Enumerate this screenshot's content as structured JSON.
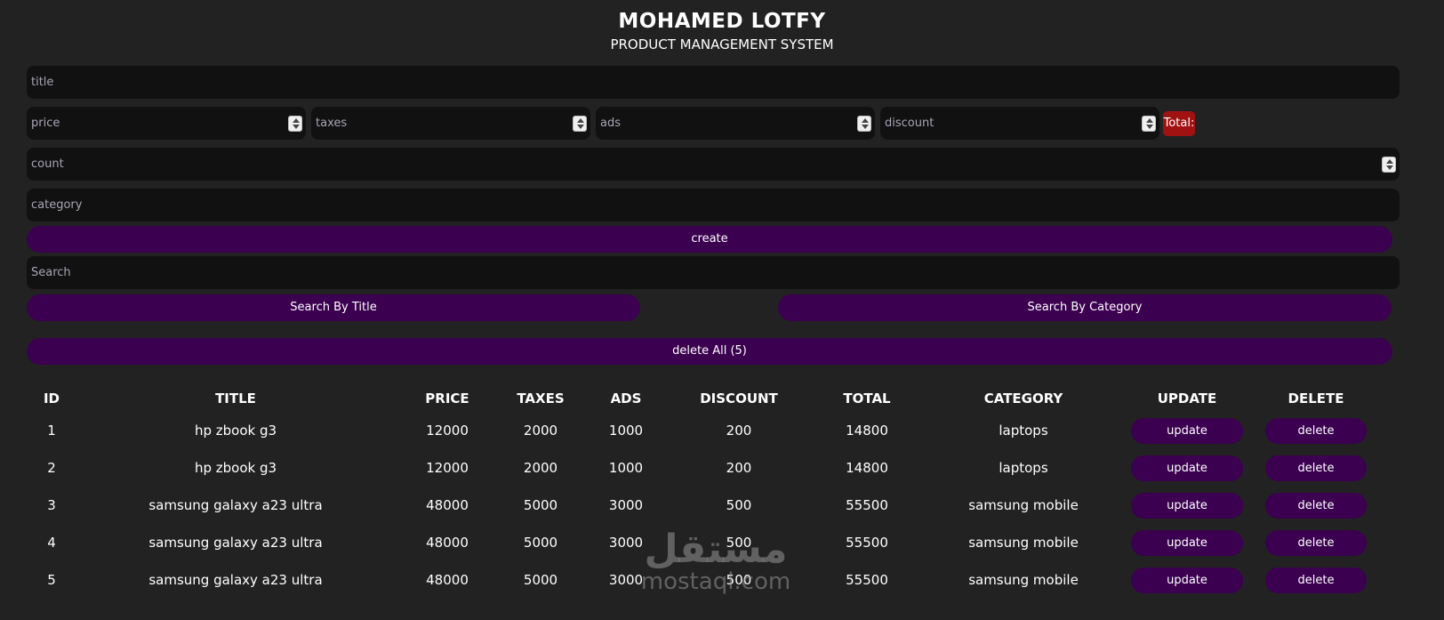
{
  "header": {
    "brand": "MOHAMED LOTFY",
    "subtitle": "PRODUCT MANAGEMENT SYSTEM"
  },
  "form": {
    "title_placeholder": "title",
    "price_placeholder": "price",
    "taxes_placeholder": "taxes",
    "ads_placeholder": "ads",
    "discount_placeholder": "discount",
    "total_label": "Total:",
    "count_placeholder": "count",
    "category_placeholder": "category",
    "create_label": "create"
  },
  "search": {
    "placeholder": "Search",
    "by_title_label": "Search By Title",
    "by_category_label": "Search By Category"
  },
  "delete_all_label": "delete All (5)",
  "table": {
    "columns": [
      "ID",
      "TITLE",
      "PRICE",
      "TAXES",
      "ADS",
      "DISCOUNT",
      "TOTAL",
      "CATEGORY",
      "UPDATE",
      "DELETE"
    ],
    "rows": [
      {
        "id": "1",
        "title": "hp zbook g3",
        "price": "12000",
        "taxes": "2000",
        "ads": "1000",
        "discount": "200",
        "total": "14800",
        "category": "laptops",
        "update": "update",
        "delete": "delete"
      },
      {
        "id": "2",
        "title": "hp zbook g3",
        "price": "12000",
        "taxes": "2000",
        "ads": "1000",
        "discount": "200",
        "total": "14800",
        "category": "laptops",
        "update": "update",
        "delete": "delete"
      },
      {
        "id": "3",
        "title": "samsung galaxy a23 ultra",
        "price": "48000",
        "taxes": "5000",
        "ads": "3000",
        "discount": "500",
        "total": "55500",
        "category": "samsung mobile",
        "update": "update",
        "delete": "delete"
      },
      {
        "id": "4",
        "title": "samsung galaxy a23 ultra",
        "price": "48000",
        "taxes": "5000",
        "ads": "3000",
        "discount": "500",
        "total": "55500",
        "category": "samsung mobile",
        "update": "update",
        "delete": "delete"
      },
      {
        "id": "5",
        "title": "samsung galaxy a23 ultra",
        "price": "48000",
        "taxes": "5000",
        "ads": "3000",
        "discount": "500",
        "total": "55500",
        "category": "samsung mobile",
        "update": "update",
        "delete": "delete"
      }
    ]
  },
  "watermark": {
    "arabic": "مستقل",
    "latin": "mostaql.com"
  },
  "colors": {
    "background": "#222222",
    "input": "#111111",
    "button": "#3b0050",
    "total_badge": "#a01212"
  }
}
